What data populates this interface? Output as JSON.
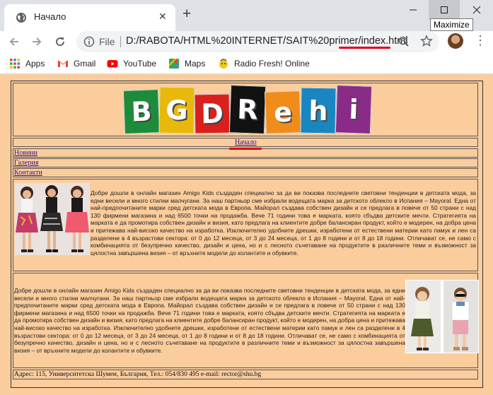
{
  "browser": {
    "tab_title": "Начало",
    "new_tab_symbol": "+",
    "window_tooltip": "Maximize",
    "address_scheme_label": "File",
    "address_url": "D:/RABOTA/HTML%20INTERNET/SAIT%20primer/index.html"
  },
  "bookmarks": [
    {
      "label": "Apps",
      "icon": "apps-grid-icon"
    },
    {
      "label": "Gmail",
      "icon": "gmail-icon"
    },
    {
      "label": "YouTube",
      "icon": "youtube-icon"
    },
    {
      "label": "Maps",
      "icon": "maps-icon"
    },
    {
      "label": "Radio Fresh! Online",
      "icon": "radio-icon"
    }
  ],
  "page": {
    "logo_letters": [
      "B",
      "G",
      "D",
      "R",
      "e",
      "h",
      "i"
    ],
    "logo_colors": [
      "#1e8b3a",
      "#e8b90b",
      "#d9201c",
      "#121212",
      "#f08c1a",
      "#1a86c0",
      "#8a2b87"
    ],
    "nav": {
      "home": "Начало",
      "news": "Новини",
      "gallery": "Галерия",
      "contacts": "Контакти"
    },
    "section1_text": "Добре дошли в онлайн магазин Amigo Kids създаден специално за да ви показва последните световни тенденции в детската мода, за едни весели и много стилни малчугани. За наш партньор сме избрали водещата марка за детското облекло в Испания – Mayoral. Една от най-предпочитаните марки сред детската мода в Европа. Майорал създава собствен дизайн и се предлага в повече от 50 страни с над 130 фирмени магазина и над 6500 точки на продажба. Вече 71 години това е марката, която сбъдва детските мечти. Стратегията на марката е да промотира собствен дизайн и визия, като предлага на клиентите добре балансиран продукт, който е модерен, на добра цена и притежава най-високо качество на изработка. Изключително удобните дрешки, изработени от естествени материи като памук и лен са разделени в 4 възрастови сектора: от 0 до 12 месеца, от 3 до 24 месеца, от 1 до 8 години и от 8 до 18 години. Отличават се, не само с комбинацията от безупречно качество, дизайн и цена, но и с лесното съчетаване на продуктите в различните теми и възможност за цялостна завършена визия – от връхните модели до колантите и обувките.",
    "section2_text": "Добре дошли в онлайн магазин Amigo Kids създаден специално за да ви показва последните световни тенденции в детската мода, за едни весели и много стилни малчугани. За наш партньор сме избрали водещата марка за детското облекло в Испания – Mayoral. Една от най-предпочитаните марки сред детската мода в Европа. Майорал създава собствен дизайн и се предлага в повече от 50 страни с над 130 фирмени магазина и над 6500 точки на продажба. Вече 71 години това е марката, която сбъдва детските мечти. Стратегията на марката е да промотира собствен дизайн и визия, като предлага на клиентите добре балансиран продукт, който е модерен, на добра цена и притежава най-високо качество на изработка. Изключително удобните дрешки, изработени от естествени материи като памук и лен са разделени в 4 възрастови сектора: от 0 до 12 месеца, от 3 до 24 месеца, от 1 до 8 години и от 8 до 18 години. Отличават се, не само с комбинацията от безупречно качество, дизайн и цена, но и с лесното съчетаване на продуктите в различните теми и възможност за цялостна завършена визия – от връхните модели до колантите и обувките.",
    "footer": "Адрес: 115, Университетска Шумен, България, Тел.: 054/830 495 e-mail: rector@shu.bg"
  }
}
